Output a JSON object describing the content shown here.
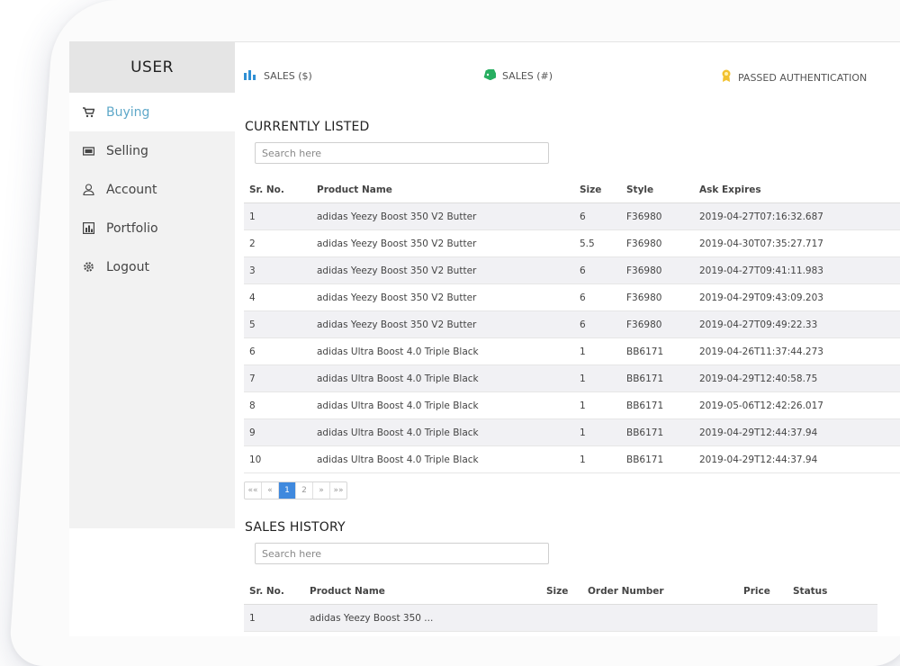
{
  "sidebar": {
    "title": "USER",
    "items": [
      {
        "label": "Buying",
        "icon": "cart-icon",
        "active": true
      },
      {
        "label": "Selling",
        "icon": "cash-icon",
        "active": false
      },
      {
        "label": "Account",
        "icon": "user-icon",
        "active": false
      },
      {
        "label": "Portfolio",
        "icon": "chart-icon",
        "active": false
      },
      {
        "label": "Logout",
        "icon": "gear-icon",
        "active": false
      }
    ]
  },
  "stats": {
    "sales_amount_label": "SALES ($)",
    "sales_count_label": "SALES (#)",
    "passed_auth_label": "PASSED AUTHENTICATION"
  },
  "colors": {
    "accent": "#5fa8c9",
    "page_active": "#3f89de",
    "stat_bar": "#2f8fd4",
    "stat_tag": "#27ae60",
    "stat_badge": "#f2c12e"
  },
  "currently_listed": {
    "title": "CURRENTLY LISTED",
    "search_placeholder": "Search here",
    "columns": [
      "Sr. No.",
      "Product Name",
      "Size",
      "Style",
      "Ask Expires"
    ],
    "rows": [
      [
        "1",
        "adidas Yeezy Boost 350 V2 Butter",
        "6",
        "F36980",
        "2019-04-27T07:16:32.687"
      ],
      [
        "2",
        "adidas Yeezy Boost 350 V2 Butter",
        "5.5",
        "F36980",
        "2019-04-30T07:35:27.717"
      ],
      [
        "3",
        "adidas Yeezy Boost 350 V2 Butter",
        "6",
        "F36980",
        "2019-04-27T09:41:11.983"
      ],
      [
        "4",
        "adidas Yeezy Boost 350 V2 Butter",
        "6",
        "F36980",
        "2019-04-29T09:43:09.203"
      ],
      [
        "5",
        "adidas Yeezy Boost 350 V2 Butter",
        "6",
        "F36980",
        "2019-04-27T09:49:22.33"
      ],
      [
        "6",
        "adidas Ultra Boost 4.0 Triple Black",
        "1",
        "BB6171",
        "2019-04-26T11:37:44.273"
      ],
      [
        "7",
        "adidas Ultra Boost 4.0 Triple Black",
        "1",
        "BB6171",
        "2019-04-29T12:40:58.75"
      ],
      [
        "8",
        "adidas Ultra Boost 4.0 Triple Black",
        "1",
        "BB6171",
        "2019-05-06T12:42:26.017"
      ],
      [
        "9",
        "adidas Ultra Boost 4.0 Triple Black",
        "1",
        "BB6171",
        "2019-04-29T12:44:37.94"
      ],
      [
        "10",
        "adidas Ultra Boost 4.0 Triple Black",
        "1",
        "BB6171",
        "2019-04-29T12:44:37.94"
      ]
    ],
    "pager": {
      "first": "««",
      "prev": "«",
      "pages": [
        "1",
        "2"
      ],
      "current": "1",
      "next": "»",
      "last": "»»"
    }
  },
  "sales_history": {
    "title": "SALES HISTORY",
    "search_placeholder": "Search here",
    "columns": [
      "Sr. No.",
      "Product Name",
      "Size",
      "Order Number",
      "Price",
      "Status"
    ],
    "rows": [
      [
        "1",
        "adidas Yeezy Boost 350 ...",
        "",
        "",
        "",
        ""
      ]
    ]
  }
}
